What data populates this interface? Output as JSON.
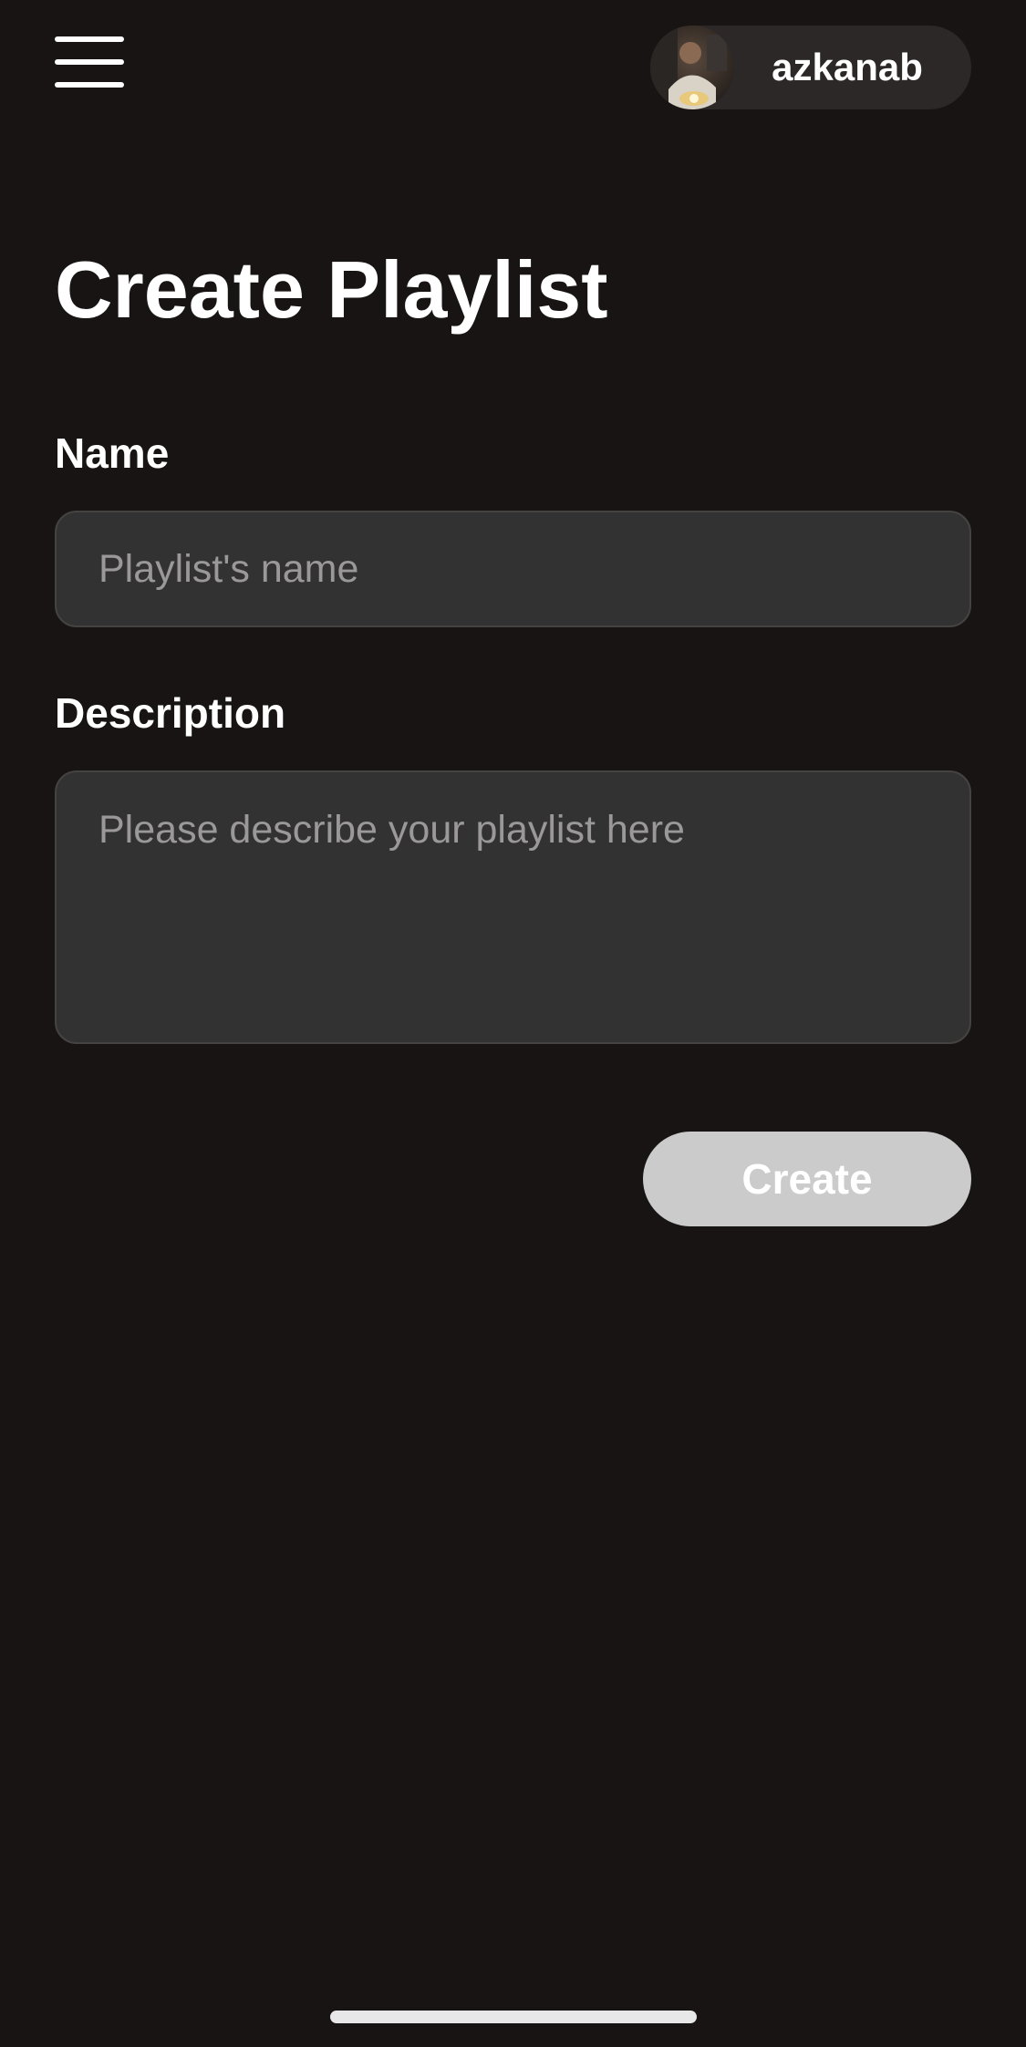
{
  "header": {
    "menu_icon": "hamburger-menu-icon",
    "user": {
      "name": "azkanab",
      "avatar": "user-avatar-photo"
    }
  },
  "main": {
    "title": "Create Playlist",
    "name_field": {
      "label": "Name",
      "value": "",
      "placeholder": "Playlist's name"
    },
    "description_field": {
      "label": "Description",
      "value": "",
      "placeholder": "Please describe your playlist here"
    },
    "create_button": {
      "label": "Create"
    }
  },
  "colors": {
    "background": "#181413",
    "input_background": "#333232",
    "pill_background": "#2c2828",
    "button_background": "#cbcbcb",
    "placeholder_text": "#9a9898"
  }
}
